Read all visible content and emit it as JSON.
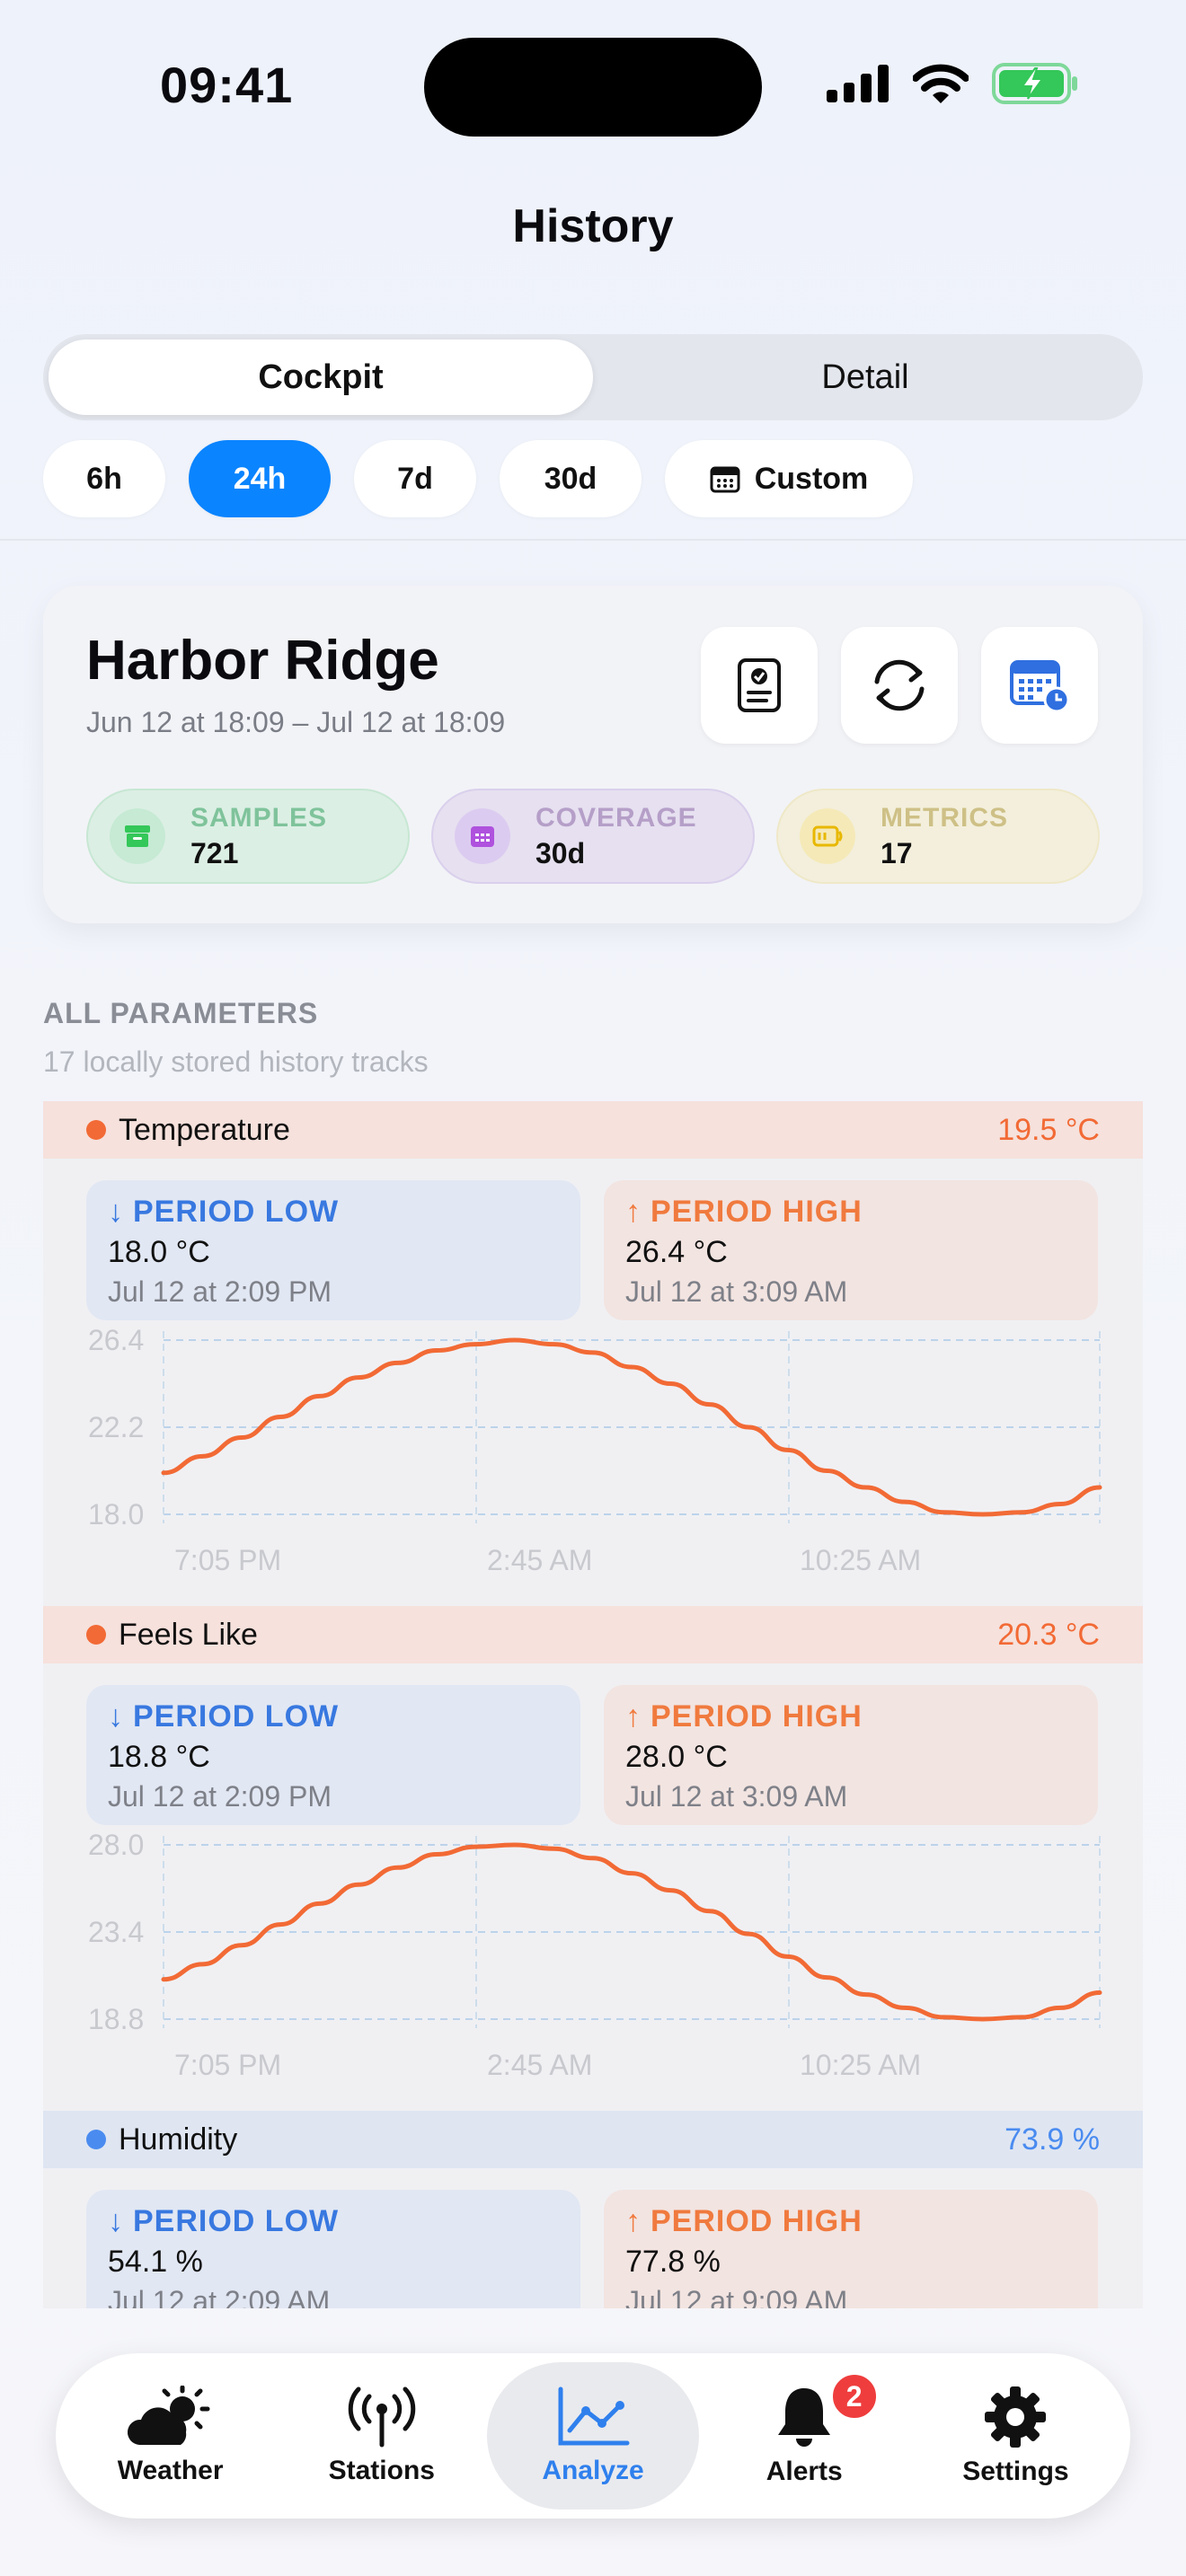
{
  "status_bar": {
    "time": "09:41"
  },
  "nav": {
    "title": "History"
  },
  "mode_tabs": [
    {
      "label": "Cockpit",
      "active": true
    },
    {
      "label": "Detail",
      "active": false
    }
  ],
  "ranges": [
    {
      "label": "6h",
      "active": false
    },
    {
      "label": "24h",
      "active": true
    },
    {
      "label": "7d",
      "active": false
    },
    {
      "label": "30d",
      "active": false
    },
    {
      "label": "Custom",
      "active": false,
      "icon": "calendar-icon"
    }
  ],
  "summary": {
    "station": "Harbor Ridge",
    "range": "Jun 12 at 18:09 – Jul 12 at 18:09",
    "actions": [
      "report-icon",
      "refresh-icon",
      "calendar-clock-icon"
    ],
    "stats": [
      {
        "label": "SAMPLES",
        "value": "721",
        "icon": "archive-icon",
        "color": "#34c759"
      },
      {
        "label": "COVERAGE",
        "value": "30d",
        "icon": "calendar-icon",
        "color": "#af52de"
      },
      {
        "label": "METRICS",
        "value": "17",
        "icon": "gauge-icon",
        "color": "#ffcc00"
      }
    ]
  },
  "section": {
    "title": "ALL PARAMETERS",
    "subtitle": "17 locally stored history tracks"
  },
  "parameters": [
    {
      "name": "Temperature",
      "current": "19.5 °C",
      "color": "#f26a35",
      "tint": "#f6e1dc",
      "low": {
        "title": "PERIOD LOW",
        "value": "18.0 °C",
        "time": "Jul 12 at 2:09 PM"
      },
      "high": {
        "title": "PERIOD HIGH",
        "value": "26.4 °C",
        "time": "Jul 12 at 3:09 AM"
      }
    },
    {
      "name": "Feels Like",
      "current": "20.3 °C",
      "color": "#f26a35",
      "tint": "#f6e1dc",
      "low": {
        "title": "PERIOD LOW",
        "value": "18.8 °C",
        "time": "Jul 12 at 2:09 PM"
      },
      "high": {
        "title": "PERIOD HIGH",
        "value": "28.0 °C",
        "time": "Jul 12 at 3:09 AM"
      }
    },
    {
      "name": "Humidity",
      "current": "73.9 %",
      "color": "#4a8bf0",
      "tint": "#dfe6f2",
      "low": {
        "title": "PERIOD LOW",
        "value": "54.1 %",
        "time": "Jul 12 at 2:09 AM"
      },
      "high": {
        "title": "PERIOD HIGH",
        "value": "77.8 %",
        "time": "Jul 12 at 9:09 AM"
      }
    }
  ],
  "chart_data": [
    {
      "type": "line",
      "title": "",
      "xlabel": "",
      "ylabel": "",
      "x_ticks": [
        "7:05 PM",
        "2:45 AM",
        "10:25 AM"
      ],
      "y_ticks": [
        "26.4",
        "22.2",
        "18.0"
      ],
      "ylim": [
        18.0,
        26.4
      ],
      "grid": true,
      "series": [
        {
          "color": "#f26a35",
          "x": [
            0,
            1,
            2,
            3,
            4,
            5,
            6,
            7,
            8,
            9,
            10,
            11,
            12,
            13,
            14,
            15,
            16,
            17,
            18,
            19,
            20,
            21,
            22,
            23,
            24
          ],
          "values": [
            20.0,
            20.8,
            21.7,
            22.7,
            23.7,
            24.6,
            25.3,
            25.9,
            26.2,
            26.4,
            26.2,
            25.8,
            25.1,
            24.3,
            23.3,
            22.2,
            21.1,
            20.1,
            19.3,
            18.6,
            18.1,
            18.0,
            18.1,
            18.5,
            19.3
          ]
        }
      ]
    },
    {
      "type": "line",
      "title": "",
      "xlabel": "",
      "ylabel": "",
      "x_ticks": [
        "7:05 PM",
        "2:45 AM",
        "10:25 AM"
      ],
      "y_ticks": [
        "28.0",
        "23.4",
        "18.8"
      ],
      "ylim": [
        18.8,
        28.0
      ],
      "grid": true,
      "series": [
        {
          "color": "#f26a35",
          "x": [
            0,
            1,
            2,
            3,
            4,
            5,
            6,
            7,
            8,
            9,
            10,
            11,
            12,
            13,
            14,
            15,
            16,
            17,
            18,
            19,
            20,
            21,
            22,
            23,
            24
          ],
          "values": [
            20.9,
            21.7,
            22.7,
            23.8,
            24.9,
            25.9,
            26.8,
            27.5,
            27.9,
            28.0,
            27.8,
            27.3,
            26.5,
            25.6,
            24.5,
            23.3,
            22.1,
            21.0,
            20.1,
            19.4,
            18.9,
            18.8,
            18.9,
            19.4,
            20.2
          ]
        }
      ]
    }
  ],
  "tabbar": [
    {
      "label": "Weather",
      "icon": "cloud-sun-icon",
      "active": false
    },
    {
      "label": "Stations",
      "icon": "antenna-icon",
      "active": false
    },
    {
      "label": "Analyze",
      "icon": "line-chart-icon",
      "active": true
    },
    {
      "label": "Alerts",
      "icon": "bell-icon",
      "active": false,
      "badge": "2"
    },
    {
      "label": "Settings",
      "icon": "gear-icon",
      "active": false
    }
  ]
}
